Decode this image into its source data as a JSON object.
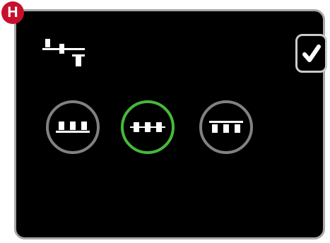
{
  "badge": {
    "label": "H",
    "color": "#c8102e"
  },
  "screen": {
    "background": "#000000",
    "border_color": "#a6a8ab"
  },
  "header": {
    "mode_icon": "stitch-alignment-icon",
    "confirm_icon": "checkmark-icon"
  },
  "options": [
    {
      "icon": "align-bottom-icon",
      "selected": false
    },
    {
      "icon": "align-center-icon",
      "selected": true
    },
    {
      "icon": "align-top-icon",
      "selected": false
    }
  ],
  "colors": {
    "selected_ring": "#47b83a",
    "unselected_ring": "#7f8183",
    "icon": "#ffffff"
  }
}
